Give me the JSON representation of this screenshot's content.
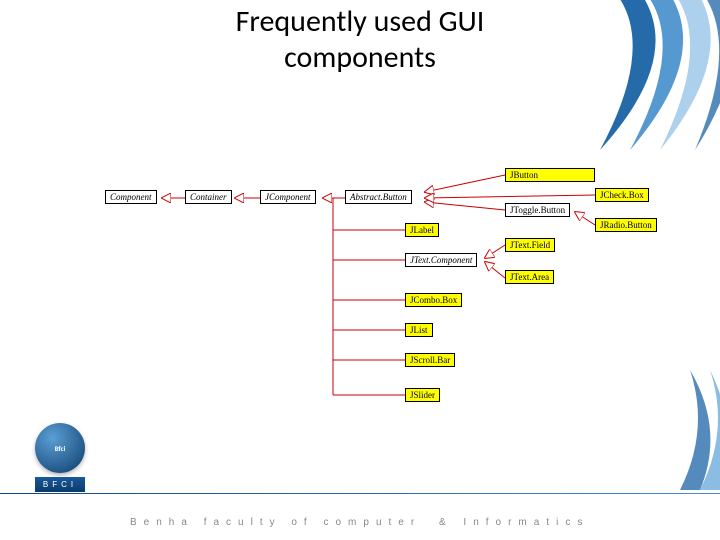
{
  "title": "Frequently used GUI components",
  "nodes": {
    "component": "Component",
    "container": "Container",
    "jcomponent": "JComponent",
    "abstract_button": "Abstract.Button",
    "jtoggle_button": "JToggle.Button",
    "jlabel": "JLabel",
    "jtext_component": "JText.Component",
    "jcombo_box": "JCombo.Box",
    "jlist": "JList",
    "jscroll_bar": "JScroll.Bar",
    "jslider": "JSlider",
    "jbutton": "JButton",
    "jcheck_box": "JCheck.Box",
    "jradio_button": "JRadio.Button",
    "jtext_field": "JText.Field",
    "jtext_area": "JText.Area"
  },
  "footer": {
    "org_abbrev": "BFCI",
    "org_full_1": "Benha faculty of computer",
    "org_full_amp": "&",
    "org_full_2": "Informatics"
  },
  "chart_data": {
    "type": "tree",
    "title": "Frequently used GUI components",
    "root": "Component",
    "edges": [
      [
        "Component",
        "Container"
      ],
      [
        "Container",
        "JComponent"
      ],
      [
        "JComponent",
        "Abstract.Button"
      ],
      [
        "JComponent",
        "JLabel"
      ],
      [
        "JComponent",
        "JText.Component"
      ],
      [
        "JComponent",
        "JCombo.Box"
      ],
      [
        "JComponent",
        "JList"
      ],
      [
        "JComponent",
        "JScroll.Bar"
      ],
      [
        "JComponent",
        "JSlider"
      ],
      [
        "Abstract.Button",
        "JButton"
      ],
      [
        "Abstract.Button",
        "JToggle.Button"
      ],
      [
        "Abstract.Button",
        "JCheck.Box"
      ],
      [
        "JToggle.Button",
        "JRadio.Button"
      ],
      [
        "JText.Component",
        "JText.Field"
      ],
      [
        "JText.Component",
        "JText.Area"
      ]
    ],
    "abstract_classes": [
      "Component",
      "Container",
      "JComponent",
      "Abstract.Button",
      "JText.Component"
    ],
    "highlighted": [
      "JButton",
      "JCheck.Box",
      "JRadio.Button",
      "JLabel",
      "JText.Field",
      "JText.Area",
      "JCombo.Box",
      "JList",
      "JScroll.Bar",
      "JSlider"
    ]
  }
}
